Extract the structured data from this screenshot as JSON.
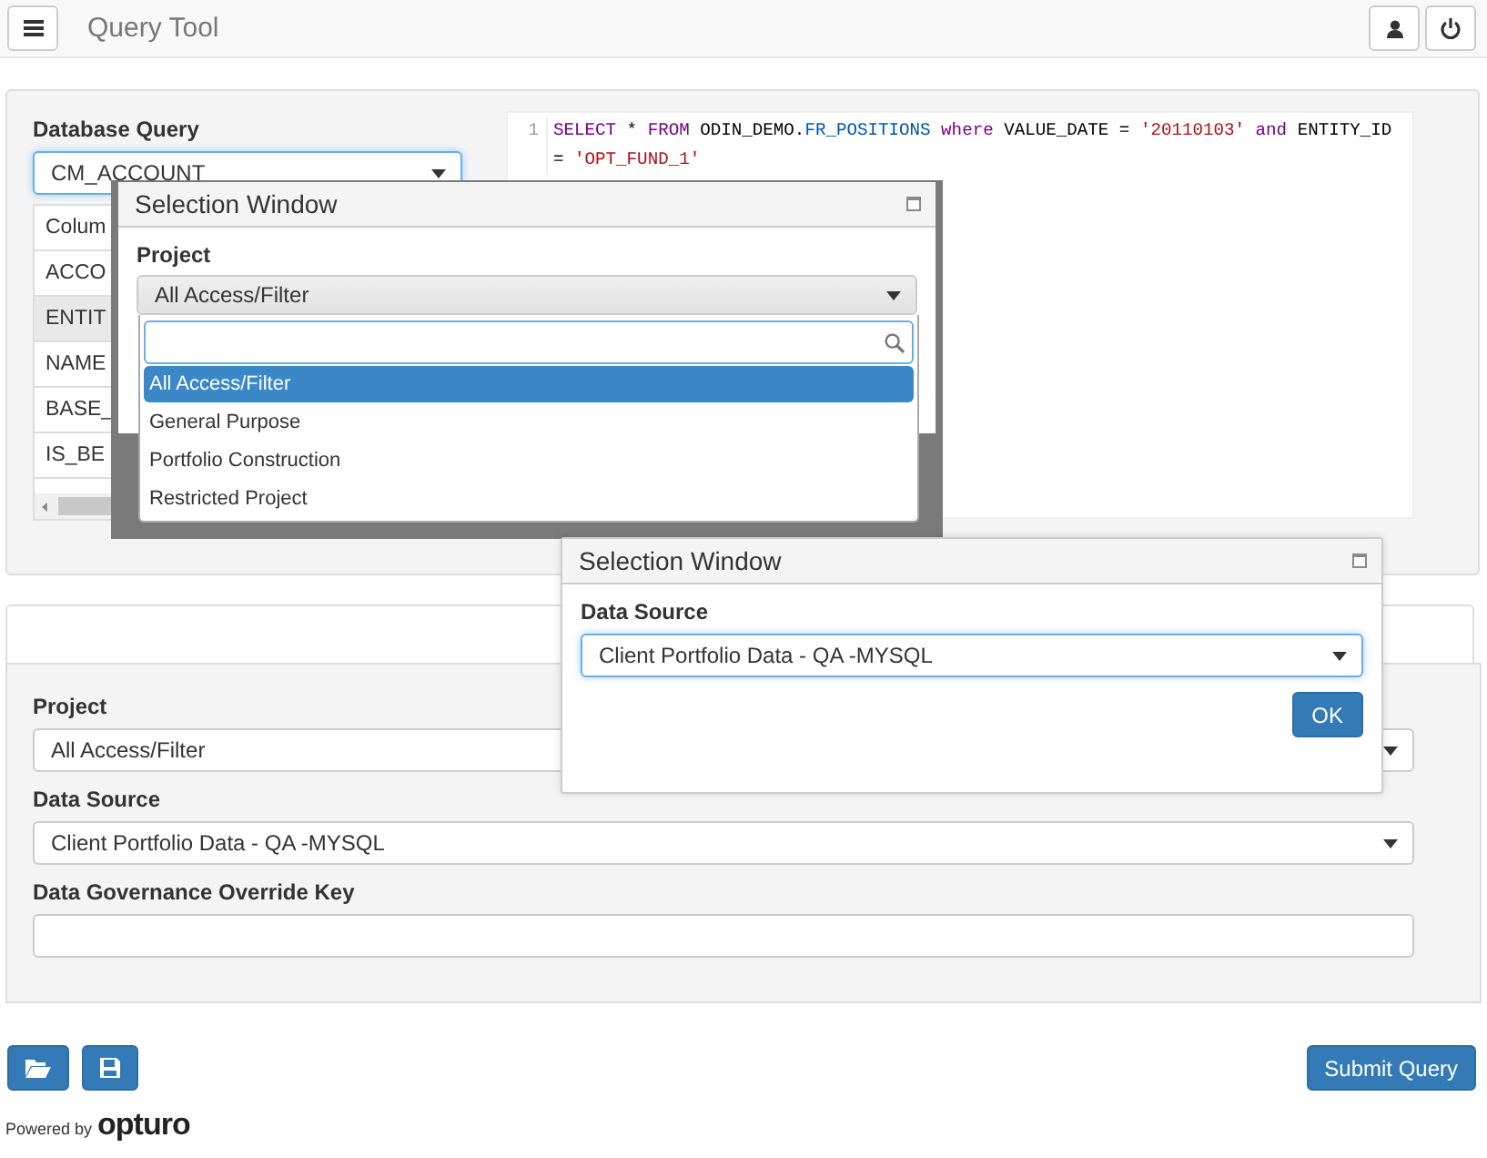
{
  "header": {
    "title": "Query Tool"
  },
  "query_panel": {
    "label": "Database Query",
    "table_select": "CM_ACCOUNT",
    "columns_table": {
      "header": "Colum",
      "rows": [
        {
          "text": "ACCO",
          "selected": false
        },
        {
          "text": "ENTIT",
          "selected": true
        },
        {
          "text": "NAME",
          "selected": false
        },
        {
          "text": "BASE_",
          "selected": false
        },
        {
          "text": "IS_BE",
          "selected": false
        }
      ]
    },
    "editor": {
      "lines": [
        {
          "number": "1",
          "tokens": [
            {
              "text": "SELECT",
              "kind": "keyword"
            },
            {
              "text": " * ",
              "kind": "plain"
            },
            {
              "text": "FROM",
              "kind": "keyword"
            },
            {
              "text": " ODIN_DEMO.",
              "kind": "plain"
            },
            {
              "text": "FR_POSITIONS",
              "kind": "table"
            },
            {
              "text": " where",
              "kind": "keyword"
            },
            {
              "text": " VALUE_DATE = ",
              "kind": "plain"
            },
            {
              "text": "'20110103'",
              "kind": "string"
            },
            {
              "text": " and",
              "kind": "keyword"
            },
            {
              "text": " ENTITY_ID = ",
              "kind": "plain"
            },
            {
              "text": "'OPT_FUND_1'",
              "kind": "string"
            }
          ]
        }
      ]
    }
  },
  "settings_panel": {
    "fields": [
      {
        "label": "Project",
        "kind": "select",
        "value": "All Access/Filter"
      },
      {
        "label": "Data Source",
        "kind": "select",
        "value": "Client Portfolio Data - QA -MYSQL"
      },
      {
        "label": "Data Governance Override Key",
        "kind": "input"
      }
    ]
  },
  "footer": {
    "submit": "Submit Query",
    "powered_by": "Powered by",
    "brand": "opturo"
  },
  "dialogs": [
    {
      "title": "Selection Window",
      "field_label": "Project",
      "select_value": "All Access/Filter",
      "dropdown": {
        "options": [
          {
            "label": "All Access/Filter",
            "selected": true
          },
          {
            "label": "General Purpose",
            "selected": false
          },
          {
            "label": "Portfolio Construction",
            "selected": false
          },
          {
            "label": "Restricted Project",
            "selected": false
          }
        ]
      }
    },
    {
      "title": "Selection Window",
      "field_label": "Data Source",
      "select_value": "Client Portfolio Data - QA -MYSQL",
      "button": "OK"
    }
  ]
}
